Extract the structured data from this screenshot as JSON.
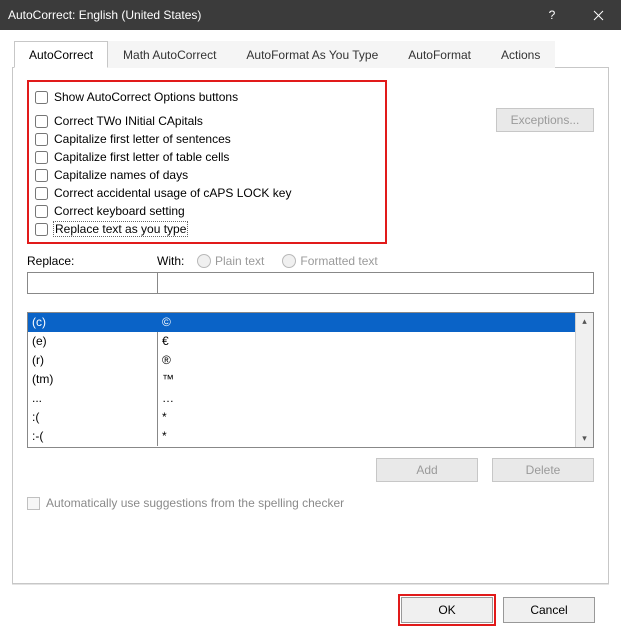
{
  "title": "AutoCorrect: English (United States)",
  "tabs": {
    "t0": "AutoCorrect",
    "t1": "Math AutoCorrect",
    "t2": "AutoFormat As You Type",
    "t3": "AutoFormat",
    "t4": "Actions"
  },
  "checks": {
    "c0": "Show AutoCorrect Options buttons",
    "c1": "Correct TWo INitial CApitals",
    "c2": "Capitalize first letter of sentences",
    "c3": "Capitalize first letter of table cells",
    "c4": "Capitalize names of days",
    "c5": "Correct accidental usage of cAPS LOCK key",
    "c6": "Correct keyboard setting",
    "c7": "Replace text as you type"
  },
  "exceptions": "Exceptions...",
  "labels": {
    "replace": "Replace:",
    "with": "With:",
    "plain": "Plain text",
    "formatted": "Formatted text"
  },
  "grid": [
    {
      "from": "(c)",
      "to": "©"
    },
    {
      "from": "(e)",
      "to": "€"
    },
    {
      "from": "(r)",
      "to": "®"
    },
    {
      "from": "(tm)",
      "to": "™"
    },
    {
      "from": "...",
      "to": "…"
    },
    {
      "from": ":(",
      "to": "*"
    },
    {
      "from": ":-(",
      "to": "*"
    }
  ],
  "buttons": {
    "add": "Add",
    "delete": "Delete",
    "ok": "OK",
    "cancel": "Cancel"
  },
  "autosuggest": "Automatically use suggestions from the spelling checker"
}
